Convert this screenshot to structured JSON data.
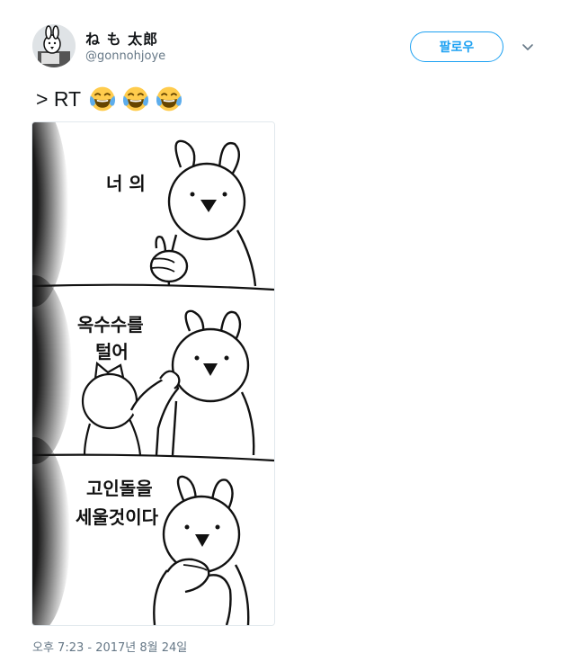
{
  "tweet": {
    "display_name": "ね も 太郎",
    "handle": "@gonnohjoye",
    "follow_label": "팔로우",
    "text": "> RT",
    "emoji_count": 3,
    "emoji_name": "face-with-tears-of-joy",
    "timestamp": "오후 7:23 - 2017년 8월 24일",
    "comic": {
      "panel1_caption": "너 의",
      "panel2_caption_line1": "옥수수를",
      "panel2_caption_line2": "털어",
      "panel3_caption_line1": "고인돌을",
      "panel3_caption_line2": "세울것이다"
    }
  },
  "colors": {
    "accent": "#1da1f2",
    "secondary_text": "#657786",
    "primary_text": "#14171a"
  }
}
